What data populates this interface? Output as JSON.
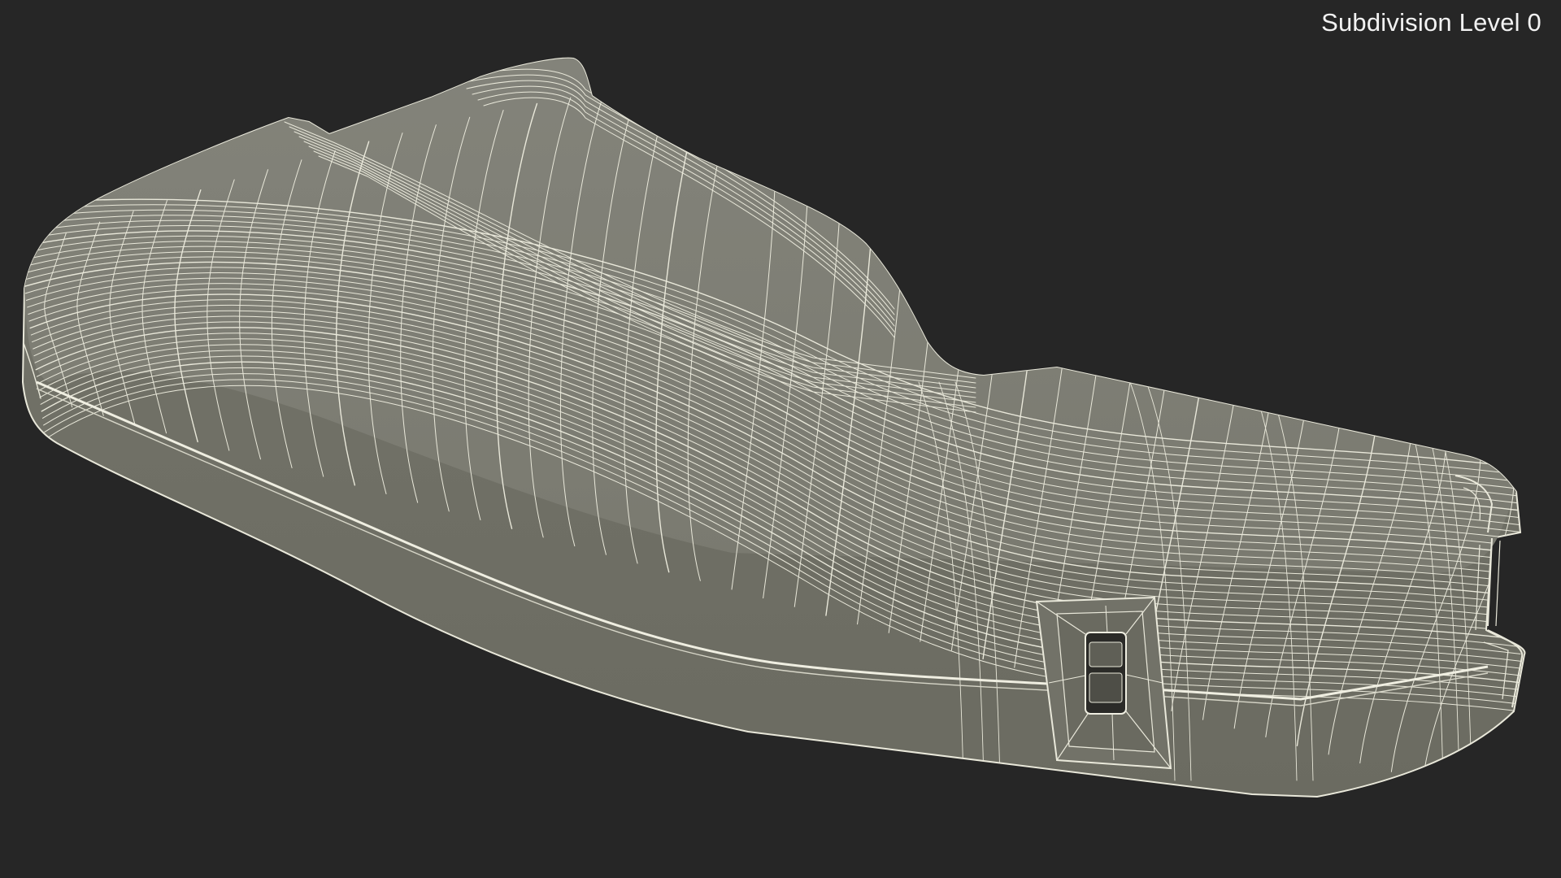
{
  "viewport": {
    "overlay_label": "Subdivision Level 0",
    "background_color": "#262626",
    "mesh_fill_color": "#7b7b6f",
    "mesh_shade_color": "#6c6c62",
    "wire_color": "#e9e8da",
    "display_mode": "wireframe-on-shaded",
    "object": "grip-stock-mesh"
  }
}
